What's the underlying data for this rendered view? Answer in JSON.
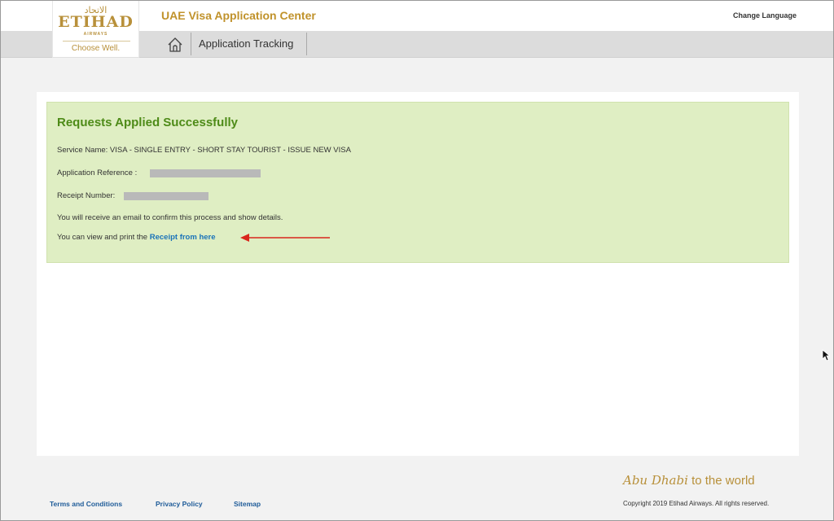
{
  "header": {
    "logo": {
      "arabic": "الاتحاد",
      "wordmark": "ETIHAD",
      "sub": "AIRWAYS",
      "tagline": "Choose Well."
    },
    "app_title": "UAE Visa Application Center",
    "change_language": "Change Language"
  },
  "nav": {
    "home_icon": "home-icon",
    "tracking_label": "Application Tracking"
  },
  "result": {
    "title": "Requests Applied Successfully",
    "service_name": "Service Name: VISA - SINGLE ENTRY - SHORT STAY TOURIST - ISSUE NEW VISA",
    "application_reference_label": "Application Reference :",
    "receipt_number_label": "Receipt Number:",
    "email_notice": "You will receive an email to confirm this process and show details.",
    "print_prefix": "You can view and print the ",
    "receipt_link": "Receipt from here"
  },
  "footer": {
    "terms": "Terms and Conditions",
    "privacy": "Privacy Policy",
    "sitemap": "Sitemap",
    "slogan_script": "Abu Dhabi",
    "slogan_rest": "to the world",
    "copyright": "Copyright 2019 Etihad Airways. All rights reserved."
  },
  "colors": {
    "brand_gold": "#b8903a",
    "success_bg": "#dfeec3",
    "success_title": "#4e8b18",
    "link_blue": "#1a73b9",
    "annotation_arrow": "#d9261c"
  }
}
